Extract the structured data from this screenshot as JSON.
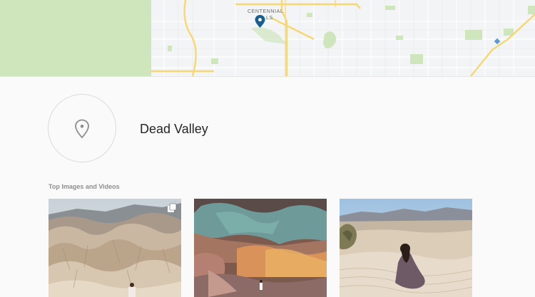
{
  "map": {
    "label_line1": "CENTENNIAL",
    "label_line2": "LS",
    "land_color": "#cfe6bd",
    "road_color": "#f7d774"
  },
  "place": {
    "name": "Dead Valley",
    "icon": "location-pin-icon"
  },
  "section": {
    "title": "Top Images and Videos"
  },
  "posts": [
    {
      "name": "badlands-hills-photo",
      "multi": true,
      "icon": "multiple-posts-icon"
    },
    {
      "name": "artists-palette-rocks-photo",
      "multi": false
    },
    {
      "name": "sand-dunes-woman-photo",
      "multi": false
    }
  ]
}
